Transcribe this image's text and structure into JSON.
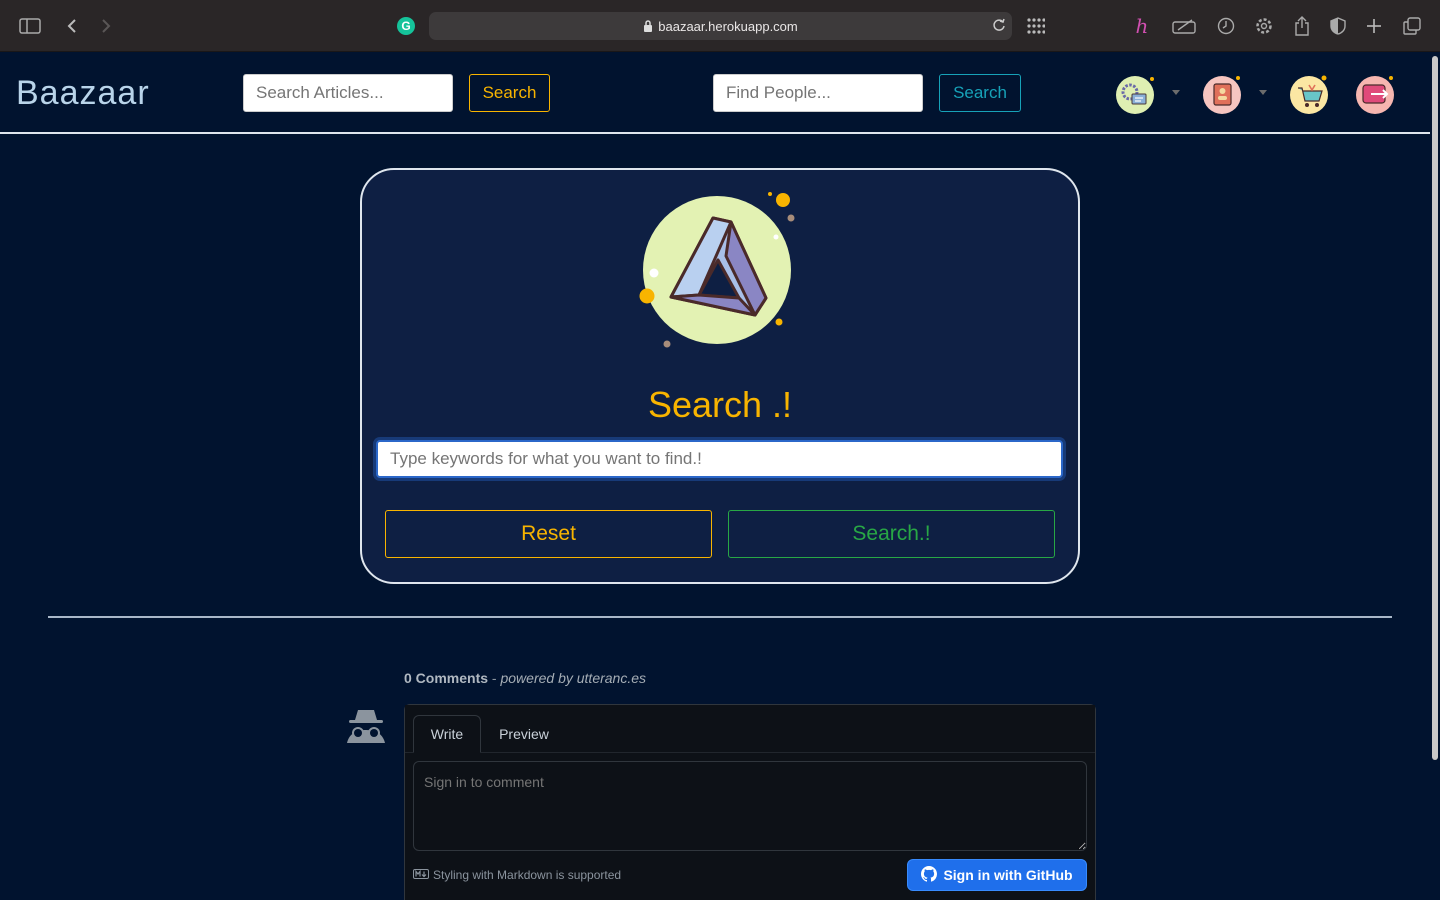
{
  "browser": {
    "url": "baazaar.herokuapp.com",
    "icons": [
      "sidebar-icon",
      "back-icon",
      "forward-icon",
      "grammarly-icon",
      "lock-icon",
      "reload-icon",
      "grid-icon",
      "honey-icon",
      "keyboard-icon",
      "history-icon",
      "settings-icon",
      "share-icon",
      "shield-icon",
      "new-tab-icon",
      "tabs-overview-icon"
    ]
  },
  "nav": {
    "brand": "Baazaar",
    "articles_placeholder": "Search Articles...",
    "articles_button": "Search",
    "people_placeholder": "Find People...",
    "people_button": "Search",
    "avatars": [
      "settings-menu-avatar",
      "address-book-avatar",
      "cart-avatar",
      "logout-avatar"
    ]
  },
  "search_card": {
    "title": "Search .!",
    "placeholder": "Type keywords for what you want to find.!",
    "reset_label": "Reset",
    "search_label": "Search.!"
  },
  "comments": {
    "count_label": "0 Comments",
    "separator": " - ",
    "powered_by": "powered by utteranc.es",
    "tab_write": "Write",
    "tab_preview": "Preview",
    "textarea_placeholder": "Sign in to comment",
    "markdown_note": "Styling with Markdown is supported",
    "signin_label": "Sign in with GitHub"
  },
  "colors": {
    "background": "#01132f",
    "card": "#0e1f43",
    "accent_warning": "#f8b400",
    "accent_success": "#28a745",
    "accent_info": "#17a2b8",
    "github_blue": "#1f6feb"
  }
}
